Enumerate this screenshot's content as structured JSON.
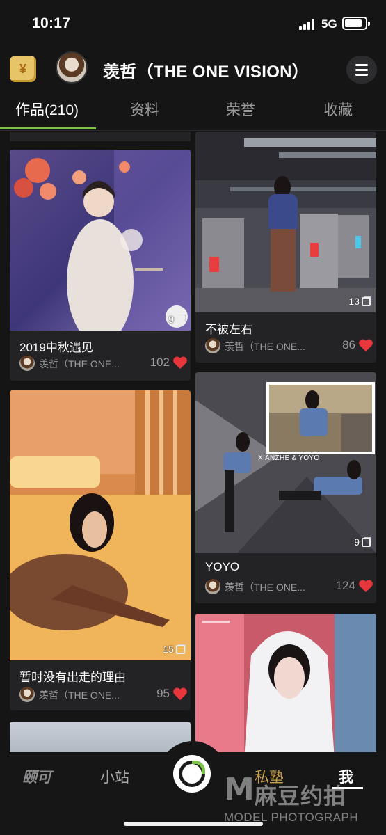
{
  "status_bar": {
    "time": "10:17",
    "network": "5G"
  },
  "header": {
    "user_name": "羡哲（THE ONE VISION）",
    "wallet_icon": "wallet-icon",
    "menu_icon": "menu-icon"
  },
  "tabs": [
    {
      "label": "作品(210)",
      "active": true
    },
    {
      "label": "资料",
      "active": false
    },
    {
      "label": "荣誉",
      "active": false
    },
    {
      "label": "收藏",
      "active": false
    }
  ],
  "works": {
    "left": [
      {
        "title": "2019中秋遇见",
        "author": "羡哲（THE ONE...",
        "likes": "102",
        "photo_count": "9"
      },
      {
        "title": "暂时没有出走的理由",
        "author": "羡哲（THE ONE...",
        "likes": "95",
        "photo_count": "15"
      }
    ],
    "right": [
      {
        "title": "不被左右",
        "author": "羡哲（THE ONE...",
        "likes": "86",
        "photo_count": "13"
      },
      {
        "title": "YOYO",
        "author": "羡哲（THE ONE...",
        "likes": "124",
        "photo_count": "9",
        "overlay_text": "XIANZHE & YOYO"
      }
    ]
  },
  "bottom_nav": {
    "item1": "颐可",
    "item2": "小站",
    "item3": "私塾",
    "item4": "我"
  },
  "watermark": {
    "mark": "M",
    "cn": "麻豆约拍",
    "en": "MODEL PHOTOGRAPH"
  },
  "colors": {
    "accent_green": "#7ec24a",
    "like_red": "#e8363d",
    "gold": "#c8a14a",
    "background": "#151516"
  }
}
